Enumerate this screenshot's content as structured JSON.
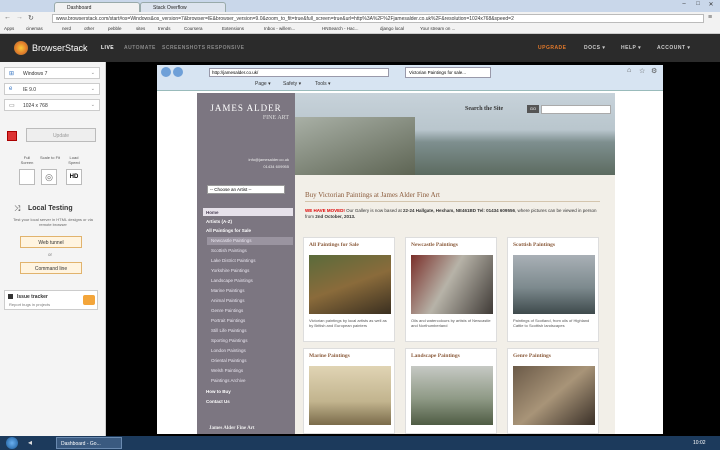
{
  "chrome": {
    "tabs": [
      "Dashboard",
      "Stack Overflow"
    ],
    "url": "www.browserstack.com/start#os=Windows&os_version=7&browser=IE&browser_version=9.0&zoom_to_fit=true&full_screen=true&url=http%3A%2F%2Fjamesalder.co.uk%2F&resolution=1024x768&speed=2",
    "bookmarks": [
      "Apps",
      "cinemas",
      "nerd",
      "other",
      "pebble",
      "sites",
      "trends",
      "Coursera",
      "Extensions",
      "Inbox - willem...",
      "HNSearch - Hac...",
      "django local",
      "Your stream on ..."
    ]
  },
  "bs": {
    "logo": "BrowserStack",
    "nav": [
      "LIVE",
      "AUTOMATE",
      "SCREENSHOTS",
      "RESPONSIVE"
    ],
    "right": [
      "UPGRADE",
      "DOCS ▾",
      "HELP ▾",
      "ACCOUNT ▾"
    ],
    "os": "Windows 7",
    "browser": "IE 9.0",
    "resolution": "1024 x 768",
    "update": "Update",
    "full_screen": "Full Screen",
    "scale_to_fit": "Scale to Fit",
    "load_speed": "Load Speed",
    "hd": "HD",
    "local_testing": "Local Testing",
    "local_desc": "Test your local server in HTML designs or via remote browser",
    "web_tunnel": "Web tunnel",
    "or": "or",
    "command_line": "Command line",
    "issue_tracker": "Issue tracker",
    "issue_desc": "Report bugs in projects"
  },
  "ie": {
    "url": "http://jamesalder.co.uk/",
    "tab": "Victorian Paintings for sale...",
    "menu": [
      "Page ▾",
      "Safety ▾",
      "Tools ▾"
    ]
  },
  "site": {
    "brand1": "JAMES ALDER",
    "brand2": "FINE ART",
    "email": "info@jamesalder.co.uk",
    "phone": "01434 609955",
    "choose": "-- Choose an Artist --",
    "search": "Search the Site",
    "go": "GO",
    "nav": [
      "Home",
      "Artists (A-Z)",
      "All Paintings for Sale",
      "Newcastle Paintings",
      "Scottish Paintings",
      "Lake District Paintings",
      "Yorkshire Paintings",
      "Landscape Paintings",
      "Marine Paintings",
      "Animal Paintings",
      "Genre Paintings",
      "Portrait Paintings",
      "Still Life Paintings",
      "Sporting Paintings",
      "London Paintings",
      "Oriental Paintings",
      "Welsh Paintings",
      "Paintings Archive",
      "How to Buy",
      "Contact Us"
    ],
    "footer": "James Alder Fine Art",
    "heading": "Buy Victorian Paintings at James Alder Fine Art",
    "moved": "WE HAVE MOVED!",
    "notice1": " Our Gallery is now based at ",
    "address": "22-24 Hallgate, Hexham, NE461BD",
    "notice2": " Tel: 01434 609556",
    "notice3": ", where pictures can be viewed in person from ",
    "date": "2nd October, 2013.",
    "cards": [
      {
        "title": "All Paintings for Sale",
        "desc": "Victorian paintings by local artists as well as by British and European painters"
      },
      {
        "title": "Newcastle Paintings",
        "desc": "Oils and watercolours by artists of Newcastle and Northumberland"
      },
      {
        "title": "Scottish Paintings",
        "desc": "Paintings of Scotland, from oils of Highland Cattle to Scottish landscapes"
      },
      {
        "title": "Marine Paintings",
        "desc": ""
      },
      {
        "title": "Landscape Paintings",
        "desc": ""
      },
      {
        "title": "Genre Paintings",
        "desc": ""
      }
    ]
  },
  "taskbar": {
    "item": "Dashboard - Go...",
    "time": "10:02"
  }
}
